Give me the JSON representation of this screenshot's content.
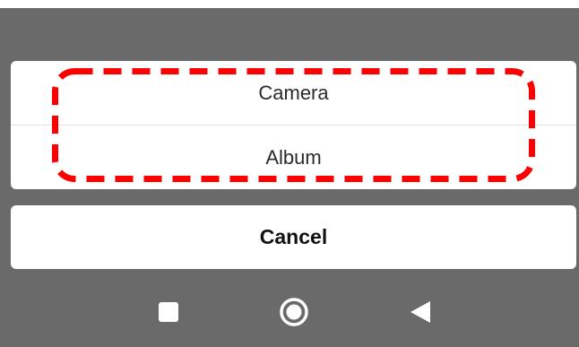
{
  "action_sheet": {
    "options": [
      {
        "label": "Camera"
      },
      {
        "label": "Album"
      }
    ],
    "cancel_label": "Cancel"
  },
  "annotation": {
    "style": "dashed-rounded-rectangle",
    "color": "#ff0000",
    "encloses": [
      "Camera",
      "Album"
    ]
  },
  "nav_bar": {
    "buttons": [
      "recent-apps-icon",
      "home-icon",
      "back-icon"
    ]
  },
  "colors": {
    "overlay": "#6a6a6a",
    "sheet": "#ffffff",
    "highlight": "#ff0000",
    "nav_icons": "#ffffff"
  }
}
